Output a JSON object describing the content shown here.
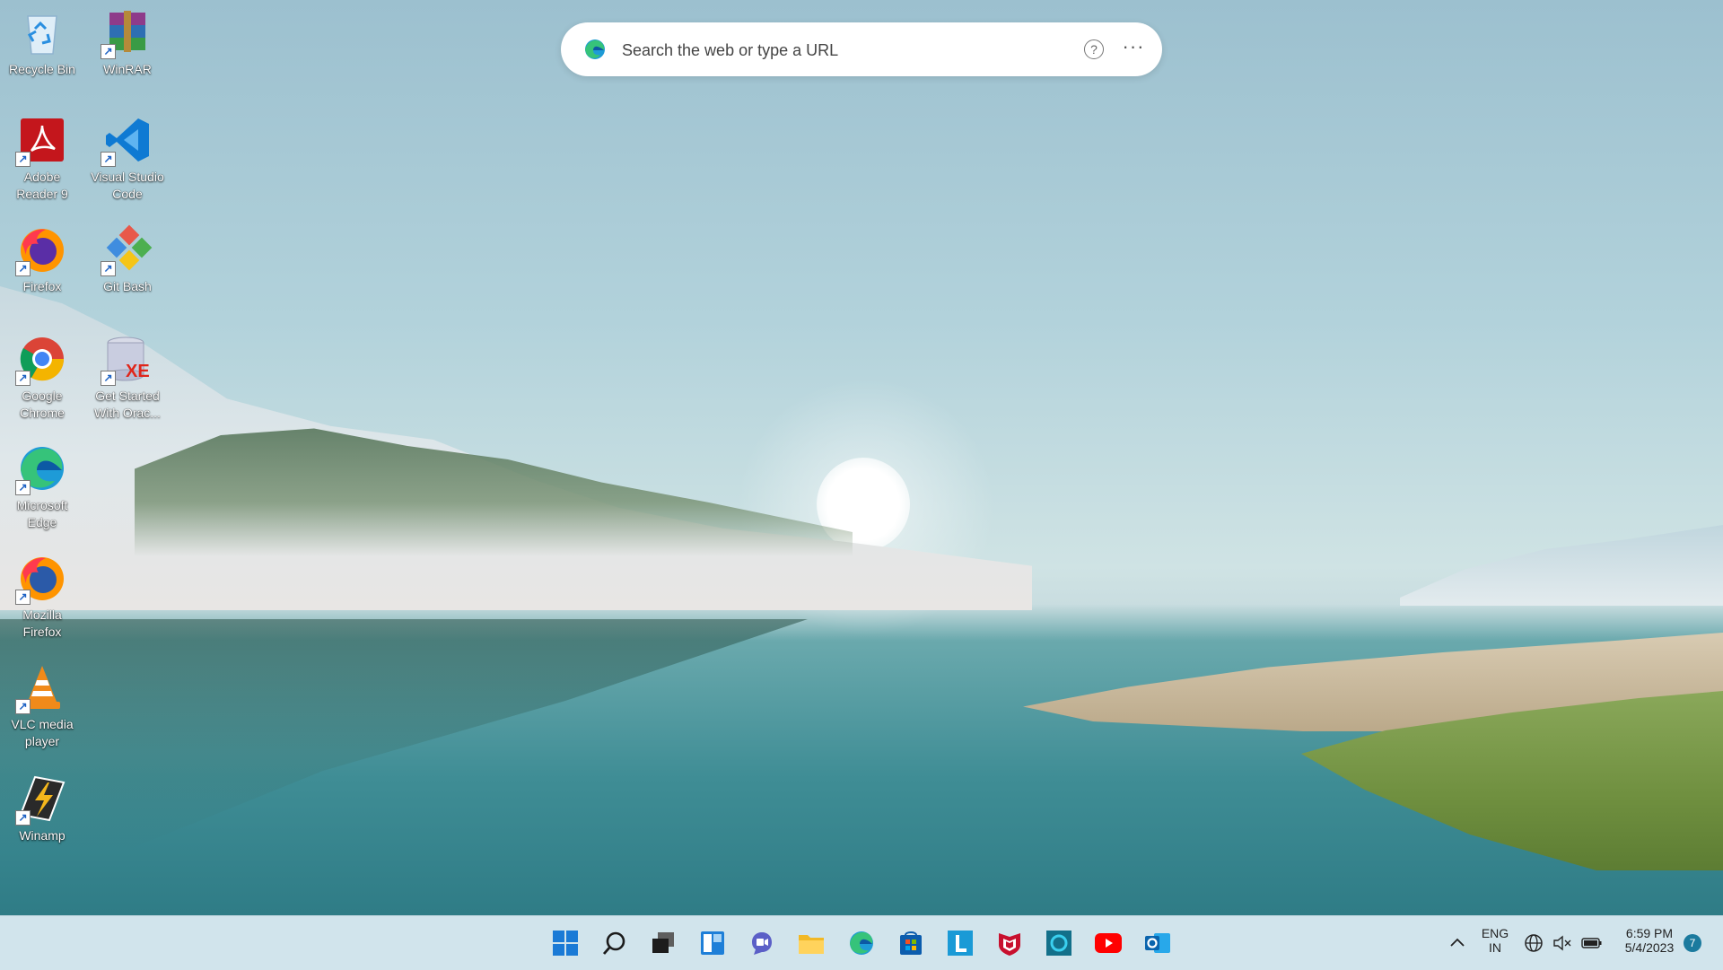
{
  "desktop": {
    "icons": [
      {
        "label": "Recycle Bin",
        "icon": "recycle-bin-icon"
      },
      {
        "label": "WinRAR",
        "icon": "winrar-icon"
      },
      {
        "label": "Adobe Reader 9",
        "icon": "adobe-reader-icon"
      },
      {
        "label": "Visual Studio Code",
        "icon": "vscode-icon"
      },
      {
        "label": "Firefox",
        "icon": "firefox-icon"
      },
      {
        "label": "Git Bash",
        "icon": "git-bash-icon"
      },
      {
        "label": "Google Chrome",
        "icon": "chrome-icon"
      },
      {
        "label": "Get Started With Orac...",
        "icon": "oracle-xe-icon"
      },
      {
        "label": "Microsoft Edge",
        "icon": "edge-icon"
      },
      {
        "label": "Mozilla Firefox",
        "icon": "mozilla-firefox-icon"
      },
      {
        "label": "VLC media player",
        "icon": "vlc-icon"
      },
      {
        "label": "Winamp",
        "icon": "winamp-icon"
      }
    ]
  },
  "search": {
    "placeholder": "Search the web or type a URL",
    "help_label": "?",
    "more_label": "···"
  },
  "taskbar": {
    "apps": [
      "windows-start-icon",
      "search-icon",
      "task-view-icon",
      "widgets-icon",
      "teams-chat-icon",
      "file-explorer-icon",
      "edge-icon",
      "microsoft-store-icon",
      "l-app-icon",
      "mcafee-icon",
      "alexa-icon",
      "youtube-icon",
      "outlook-icon"
    ],
    "tray": {
      "language_line1": "ENG",
      "language_line2": "IN",
      "time": "6:59 PM",
      "date": "5/4/2023",
      "notification_count": "7"
    }
  },
  "colors": {
    "taskbar_bg": "#d1e4ec",
    "accent_blue": "#0a6cd6",
    "notification_badge": "#1b7a9e"
  }
}
